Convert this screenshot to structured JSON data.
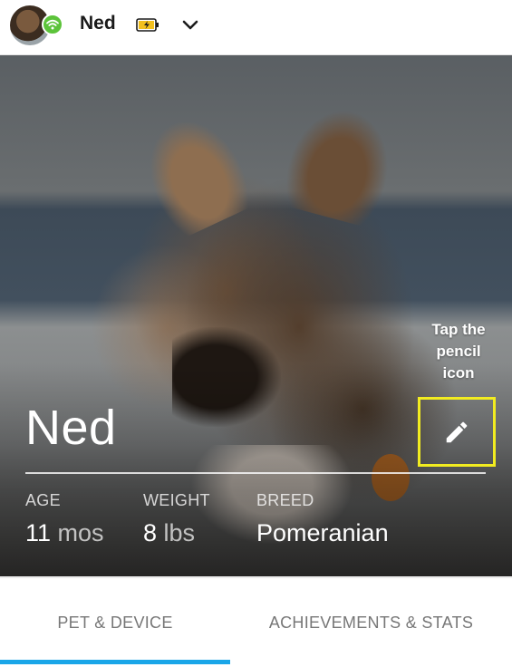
{
  "header": {
    "pet_name": "Ned",
    "avatar_icon": "pet-avatar",
    "status_icon": "wifi-icon",
    "status_color": "#5cc33a",
    "battery_icon": "battery-charging-icon",
    "dropdown_icon": "chevron-down-icon"
  },
  "hero": {
    "pet_name": "Ned",
    "hint_text": "Tap the pencil icon",
    "edit_icon": "pencil-icon",
    "highlight_color": "#f2ec20",
    "stats": [
      {
        "label": "AGE",
        "value": "11",
        "unit": "mos"
      },
      {
        "label": "WEIGHT",
        "value": "8",
        "unit": "lbs"
      },
      {
        "label": "BREED",
        "value": "Pomeranian",
        "unit": ""
      }
    ]
  },
  "tabs": [
    {
      "label": "PET & DEVICE",
      "active": true
    },
    {
      "label": "ACHIEVEMENTS & STATS",
      "active": false
    }
  ],
  "accent_color": "#1aa6e8"
}
